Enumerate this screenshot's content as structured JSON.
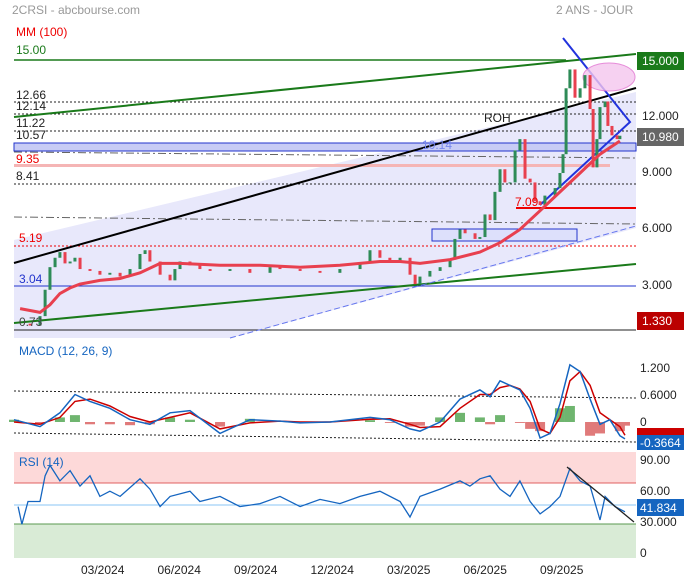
{
  "header": {
    "symbol": "2CRSI - abcbourse.com",
    "period": "2 ANS - JOUR"
  },
  "colors": {
    "up": "#2e8b57",
    "down": "#e8404f",
    "ma": "#e8404f",
    "macd": "#1565c0",
    "signal": "#cc0000",
    "rsi": "#1565c0"
  },
  "chart_data": [
    {
      "type": "line",
      "title": "MM (100)",
      "x_unit": "months since 2024-01",
      "x_ticks": [
        "03/2024",
        "06/2024",
        "09/2024",
        "12/2024",
        "03/2025",
        "06/2025",
        "09/2025"
      ],
      "x_tick_values": [
        2,
        5,
        8,
        11,
        14,
        17,
        20
      ],
      "ylim": [
        0.5,
        16.5
      ],
      "y_ticks": [
        "15.000",
        "12.000",
        "9.000",
        "6.000",
        "3.000"
      ],
      "y_tick_values": [
        15,
        12,
        9,
        6,
        3
      ],
      "last_price_label": "10.980",
      "last_price": 10.98,
      "tag_15": "15.000",
      "tag_low": "1.330",
      "levels": [
        {
          "label": "15.00",
          "value": 15
        },
        {
          "label": "12.66",
          "value": 12.66
        },
        {
          "label": "12.14",
          "value": 12.14
        },
        {
          "label": "11.22",
          "value": 11.22
        },
        {
          "label": "10.57",
          "value": 10.57
        },
        {
          "label": "10.14",
          "value": 10.14
        },
        {
          "label": "9.35",
          "value": 9.35
        },
        {
          "label": "8.41",
          "value": 8.41
        },
        {
          "label": "7.09",
          "value": 7.09
        },
        {
          "label": "5.19",
          "value": 5.19
        },
        {
          "label": "3.04",
          "value": 3.04
        },
        {
          "label": "0.73",
          "value": 0.73
        }
      ],
      "annotation": "ROH",
      "price": [
        [
          -1.25,
          1.0
        ],
        [
          -0.86,
          0.9
        ],
        [
          -0.47,
          1.4
        ],
        [
          -0.27,
          2.8
        ],
        [
          -0.08,
          4.0
        ],
        [
          0.12,
          4.5
        ],
        [
          0.31,
          4.8
        ],
        [
          0.51,
          4.2
        ],
        [
          0.71,
          4.3
        ],
        [
          0.9,
          4.5
        ],
        [
          1.1,
          3.9
        ],
        [
          1.49,
          3.8
        ],
        [
          1.88,
          3.6
        ],
        [
          2.27,
          3.7
        ],
        [
          2.67,
          3.5
        ],
        [
          3.06,
          3.9
        ],
        [
          3.45,
          4.7
        ],
        [
          3.65,
          4.9
        ],
        [
          3.84,
          4.3
        ],
        [
          4.24,
          3.6
        ],
        [
          4.63,
          3.3
        ],
        [
          4.82,
          3.9
        ],
        [
          5.02,
          4.3
        ],
        [
          5.41,
          4.1
        ],
        [
          5.8,
          3.9
        ],
        [
          6.2,
          3.8
        ],
        [
          6.98,
          3.9
        ],
        [
          7.76,
          3.7
        ],
        [
          8.55,
          4.0
        ],
        [
          8.94,
          3.9
        ],
        [
          9.73,
          3.8
        ],
        [
          10.51,
          3.7
        ],
        [
          11.29,
          3.9
        ],
        [
          12.08,
          4.2
        ],
        [
          12.47,
          4.9
        ],
        [
          12.86,
          4.5
        ],
        [
          13.25,
          4.3
        ],
        [
          13.65,
          4.5
        ],
        [
          14.04,
          3.6
        ],
        [
          14.24,
          3.1
        ],
        [
          14.43,
          3.5
        ],
        [
          14.82,
          3.8
        ],
        [
          15.22,
          4.0
        ],
        [
          15.61,
          4.4
        ],
        [
          15.8,
          5.5
        ],
        [
          16.0,
          6.0
        ],
        [
          16.2,
          5.8
        ],
        [
          16.59,
          5.5
        ],
        [
          16.78,
          5.6
        ],
        [
          16.98,
          6.8
        ],
        [
          17.18,
          6.5
        ],
        [
          17.37,
          8.0
        ],
        [
          17.57,
          9.2
        ],
        [
          17.76,
          8.5
        ],
        [
          17.96,
          8.5
        ],
        [
          18.16,
          10.2
        ],
        [
          18.35,
          10.8
        ],
        [
          18.55,
          8.7
        ],
        [
          18.75,
          8.5
        ],
        [
          18.94,
          7.5
        ],
        [
          19.14,
          7.3
        ],
        [
          19.33,
          7.8
        ],
        [
          19.73,
          8.2
        ],
        [
          19.92,
          9.0
        ],
        [
          20.04,
          10.0
        ],
        [
          20.16,
          13.5
        ],
        [
          20.31,
          14.5
        ],
        [
          20.51,
          13.0
        ],
        [
          20.71,
          13.5
        ],
        [
          20.9,
          14.2
        ],
        [
          21.1,
          12.4
        ],
        [
          21.22,
          9.3
        ],
        [
          21.37,
          10.8
        ],
        [
          21.49,
          12.5
        ],
        [
          21.69,
          12.8
        ],
        [
          21.8,
          11.5
        ],
        [
          21.96,
          11.0
        ],
        [
          22.16,
          10.8
        ],
        [
          22.27,
          10.98
        ]
      ],
      "ma100": [
        [
          -1.25,
          1.8
        ],
        [
          -0.47,
          1.6
        ],
        [
          -0.08,
          2.0
        ],
        [
          0.31,
          2.6
        ],
        [
          0.71,
          2.9
        ],
        [
          1.1,
          3.1
        ],
        [
          1.88,
          3.3
        ],
        [
          2.67,
          3.4
        ],
        [
          3.45,
          3.7
        ],
        [
          4.24,
          4.2
        ],
        [
          5.02,
          4.2
        ],
        [
          6.59,
          4.1
        ],
        [
          8.16,
          4.1
        ],
        [
          9.73,
          4.0
        ],
        [
          11.29,
          4.1
        ],
        [
          12.86,
          4.3
        ],
        [
          13.65,
          4.3
        ],
        [
          14.43,
          4.2
        ],
        [
          15.61,
          4.4
        ],
        [
          16.78,
          4.8
        ],
        [
          17.57,
          5.3
        ],
        [
          18.35,
          6.0
        ],
        [
          19.14,
          7.0
        ],
        [
          19.92,
          8.0
        ],
        [
          20.71,
          9.0
        ],
        [
          21.49,
          10.0
        ],
        [
          22.27,
          10.7
        ]
      ]
    },
    {
      "type": "line",
      "title": "MACD (12, 26, 9)",
      "ylim": [
        -0.45,
        1.3
      ],
      "y_ticks": [
        "1.200",
        "0.6000",
        "0"
      ],
      "y_tick_values": [
        1.2,
        0.6,
        0
      ],
      "last_macd_label": "-0.3664",
      "macd": [
        [
          -1.49,
          0.05
        ],
        [
          -0.47,
          -0.1
        ],
        [
          0.31,
          0.2
        ],
        [
          0.9,
          0.6
        ],
        [
          1.49,
          0.45
        ],
        [
          2.27,
          0.3
        ],
        [
          3.06,
          0.05
        ],
        [
          3.84,
          -0.05
        ],
        [
          4.63,
          0.2
        ],
        [
          5.41,
          0.25
        ],
        [
          6.59,
          -0.25
        ],
        [
          7.76,
          0.05
        ],
        [
          8.94,
          0.02
        ],
        [
          9.73,
          -0.02
        ],
        [
          10.9,
          0.0
        ],
        [
          12.47,
          0.1
        ],
        [
          13.25,
          0.05
        ],
        [
          14.04,
          -0.15
        ],
        [
          14.43,
          -0.2
        ],
        [
          15.22,
          0.0
        ],
        [
          16.0,
          0.5
        ],
        [
          16.78,
          0.7
        ],
        [
          17.18,
          0.55
        ],
        [
          17.57,
          0.9
        ],
        [
          17.96,
          0.8
        ],
        [
          18.35,
          0.7
        ],
        [
          18.75,
          0.3
        ],
        [
          19.14,
          -0.35
        ],
        [
          19.53,
          -0.25
        ],
        [
          19.92,
          0.4
        ],
        [
          20.31,
          1.25
        ],
        [
          20.71,
          1.1
        ],
        [
          21.1,
          0.5
        ],
        [
          21.49,
          -0.05
        ],
        [
          21.88,
          0.05
        ],
        [
          22.27,
          -0.3
        ],
        [
          22.47,
          -0.37
        ]
      ],
      "signal": [
        [
          -1.49,
          0.0
        ],
        [
          -0.47,
          -0.05
        ],
        [
          0.31,
          0.1
        ],
        [
          0.9,
          0.45
        ],
        [
          1.49,
          0.5
        ],
        [
          2.27,
          0.35
        ],
        [
          3.06,
          0.12
        ],
        [
          3.84,
          0.0
        ],
        [
          4.63,
          0.1
        ],
        [
          5.41,
          0.2
        ],
        [
          6.59,
          -0.15
        ],
        [
          7.76,
          -0.02
        ],
        [
          8.94,
          0.02
        ],
        [
          9.73,
          0.0
        ],
        [
          10.9,
          0.0
        ],
        [
          12.47,
          0.06
        ],
        [
          13.25,
          0.07
        ],
        [
          14.04,
          -0.05
        ],
        [
          14.43,
          -0.12
        ],
        [
          15.22,
          -0.1
        ],
        [
          16.0,
          0.3
        ],
        [
          16.78,
          0.6
        ],
        [
          17.18,
          0.6
        ],
        [
          17.57,
          0.75
        ],
        [
          17.96,
          0.8
        ],
        [
          18.35,
          0.72
        ],
        [
          18.75,
          0.45
        ],
        [
          19.14,
          -0.15
        ],
        [
          19.53,
          -0.25
        ],
        [
          19.92,
          0.1
        ],
        [
          20.31,
          0.9
        ],
        [
          20.71,
          1.1
        ],
        [
          21.1,
          0.8
        ],
        [
          21.49,
          0.2
        ],
        [
          21.88,
          0.05
        ],
        [
          22.27,
          -0.1
        ],
        [
          22.47,
          -0.29
        ]
      ]
    },
    {
      "type": "line",
      "title": "RSI (14)",
      "ylim": [
        0,
        100
      ],
      "y_ticks": [
        "90.00",
        "60.00",
        "30.000",
        "0"
      ],
      "y_tick_values": [
        90,
        60,
        30,
        0
      ],
      "overbought": 70,
      "oversold": 30,
      "mid": 41.834,
      "last_rsi_label": "41.834",
      "rsi": [
        [
          -1.33,
          45
        ],
        [
          -1.18,
          28
        ],
        [
          -0.94,
          50
        ],
        [
          -0.47,
          50
        ],
        [
          -0.27,
          75
        ],
        [
          -0.08,
          85
        ],
        [
          0.31,
          70
        ],
        [
          0.71,
          80
        ],
        [
          1.1,
          65
        ],
        [
          1.49,
          75
        ],
        [
          1.88,
          55
        ],
        [
          2.27,
          60
        ],
        [
          2.67,
          55
        ],
        [
          3.45,
          72
        ],
        [
          3.84,
          62
        ],
        [
          4.24,
          45
        ],
        [
          4.63,
          55
        ],
        [
          5.41,
          60
        ],
        [
          5.8,
          50
        ],
        [
          6.59,
          55
        ],
        [
          7.37,
          45
        ],
        [
          8.16,
          48
        ],
        [
          8.94,
          55
        ],
        [
          9.73,
          45
        ],
        [
          10.51,
          52
        ],
        [
          11.29,
          48
        ],
        [
          12.08,
          55
        ],
        [
          12.86,
          60
        ],
        [
          13.65,
          50
        ],
        [
          14.04,
          35
        ],
        [
          14.43,
          55
        ],
        [
          15.22,
          62
        ],
        [
          16.0,
          70
        ],
        [
          16.39,
          65
        ],
        [
          16.78,
          72
        ],
        [
          17.18,
          75
        ],
        [
          17.57,
          62
        ],
        [
          17.96,
          55
        ],
        [
          18.35,
          70
        ],
        [
          18.75,
          50
        ],
        [
          19.14,
          38
        ],
        [
          19.53,
          45
        ],
        [
          19.92,
          55
        ],
        [
          20.31,
          82
        ],
        [
          20.71,
          70
        ],
        [
          21.1,
          65
        ],
        [
          21.49,
          32
        ],
        [
          21.69,
          55
        ],
        [
          22.08,
          45
        ],
        [
          22.47,
          40
        ]
      ]
    }
  ]
}
